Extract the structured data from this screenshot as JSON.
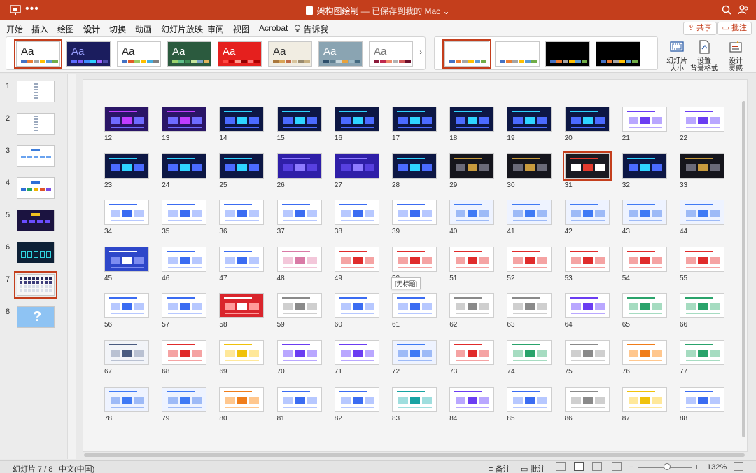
{
  "titlebar": {
    "doc_name": "架构图绘制",
    "save_status": " — 已保存到我的 Mac",
    "chevron": "⌄",
    "more": "•••"
  },
  "menu": {
    "tabs": [
      "开始",
      "插入",
      "绘图",
      "设计",
      "切换",
      "动画",
      "幻灯片放映",
      "审阅",
      "视图",
      "Acrobat",
      "告诉我"
    ],
    "active_tab": "设计",
    "share": "共享",
    "comment": "批注"
  },
  "ribbon": {
    "theme_label": "Aa",
    "themes": [
      {
        "bg": "#ffffff",
        "fg": "#222222",
        "bars": [
          "#4472c4",
          "#ed7d31",
          "#a5a5a5",
          "#ffc000",
          "#5b9bd5",
          "#70ad47"
        ]
      },
      {
        "bg": "#1b1d5e",
        "fg": "#9aa0ff",
        "bars": [
          "#5b6cff",
          "#7b58ff",
          "#3d8bff",
          "#2bd0ff",
          "#9d65ff",
          "#4b4ba8"
        ]
      },
      {
        "bg": "#ffffff",
        "fg": "#222222",
        "bars": [
          "#4472c4",
          "#e15b26",
          "#9ccb64",
          "#ffc000",
          "#44aee0",
          "#7f7f7f"
        ]
      },
      {
        "bg": "#2b5a3e",
        "fg": "#ffffff",
        "bars": [
          "#9bd36e",
          "#5fbf8a",
          "#3e8f56",
          "#c5e49c",
          "#7aa2c8",
          "#e2b35d"
        ]
      },
      {
        "bg": "#e5201e",
        "fg": "#ffffff",
        "bars": [
          "#ff4a44",
          "#c00000",
          "#ff9c8f",
          "#8f0000",
          "#f77",
          "#a80000"
        ]
      },
      {
        "bg": "#f1ede2",
        "fg": "#333333",
        "bars": [
          "#a9773b",
          "#d9a557",
          "#c06a45",
          "#d8c49c",
          "#9a8b6e",
          "#c9b182"
        ]
      },
      {
        "bg": "#8aa4b2",
        "fg": "#ffffff",
        "bars": [
          "#2e4f6b",
          "#5e7f91",
          "#c8d8de",
          "#e8a33d",
          "#9cbac7",
          "#436a80"
        ]
      },
      {
        "bg": "#ffffff",
        "fg": "#777777",
        "bars": [
          "#8b1a3a",
          "#c0294e",
          "#ef8c6a",
          "#b3b3b3",
          "#d35b5b",
          "#6b0f2a"
        ]
      }
    ],
    "variants": [
      {
        "bg": "#ffffff",
        "bars": [
          "#4472c4",
          "#ed7d31",
          "#a5a5a5",
          "#ffc000",
          "#5b9bd5",
          "#70ad47"
        ]
      },
      {
        "bg": "#ffffff",
        "bars": [
          "#4472c4",
          "#ed7d31",
          "#a5a5a5",
          "#ffc000",
          "#5b9bd5",
          "#70ad47"
        ]
      },
      {
        "bg": "#000000",
        "bars": [
          "#4472c4",
          "#ed7d31",
          "#a5a5a5",
          "#ffc000",
          "#5b9bd5",
          "#70ad47"
        ]
      },
      {
        "bg": "#000000",
        "bars": [
          "#4472c4",
          "#ed7d31",
          "#a5a5a5",
          "#ffc000",
          "#5b9bd5",
          "#70ad47"
        ]
      }
    ],
    "slide_size_l1": "幻灯片",
    "slide_size_l2": "大小",
    "format_bg_l1": "设置",
    "format_bg_l2": "背景格式",
    "designer_l1": "设计",
    "designer_l2": "灵感",
    "gallery_more": "›"
  },
  "left_thumbs": [
    {
      "num": "1",
      "kind": "vertical"
    },
    {
      "num": "2",
      "kind": "vertical"
    },
    {
      "num": "3",
      "kind": "tree-blue"
    },
    {
      "num": "4",
      "kind": "tree-color"
    },
    {
      "num": "5",
      "kind": "dark-tree"
    },
    {
      "num": "6",
      "kind": "teal-dark"
    },
    {
      "num": "7",
      "kind": "sorter"
    },
    {
      "num": "8",
      "kind": "question"
    }
  ],
  "slides": {
    "first": 12,
    "last": 88,
    "per_row": 11,
    "selected": 31,
    "tooltip_on": 50,
    "tooltip": "[无标题]",
    "styles": {
      "12": "purple",
      "13": "purple",
      "14": "navy",
      "15": "navy",
      "16": "navy",
      "17": "navy",
      "18": "navy",
      "19": "navy",
      "20": "navy",
      "21": "white-purple",
      "22": "white-purple",
      "23": "navy",
      "24": "navy",
      "25": "navy",
      "26": "violet",
      "27": "violet",
      "28": "navy",
      "29": "black",
      "30": "black",
      "31": "black-red",
      "32": "navy",
      "33": "black",
      "34": "white-blue",
      "35": "white-blue",
      "36": "white-blue",
      "37": "white-blue",
      "38": "white-blue",
      "39": "white-blue",
      "40": "light-blue",
      "41": "light-blue",
      "42": "light-blue",
      "43": "light-blue",
      "44": "light-blue",
      "45": "blue-dark",
      "46": "white-blue",
      "47": "white-blue",
      "48": "white-pink",
      "49": "white-red",
      "50": "white-red",
      "51": "white-red",
      "52": "white-red",
      "53": "white-red",
      "54": "white-red",
      "55": "white-red",
      "56": "white-blue",
      "57": "white-blue",
      "58": "red",
      "59": "white-gray",
      "60": "white-blue",
      "61": "white-blue",
      "62": "white-gray",
      "63": "white-gray",
      "64": "white-purple",
      "65": "white-green",
      "66": "white-green",
      "67": "light-gray",
      "68": "white-red",
      "69": "white-yellow",
      "70": "white-purple",
      "71": "white-purple",
      "72": "light-blue",
      "73": "white-red",
      "74": "white-green",
      "75": "white-gray",
      "76": "white-orange",
      "77": "white-green",
      "78": "light-blue",
      "79": "light-blue",
      "80": "white-orange",
      "81": "white-blue",
      "82": "white-blue",
      "83": "white-teal",
      "84": "white-purple",
      "85": "white-blue",
      "86": "white-gray",
      "87": "white-yellow",
      "88": "white-blue"
    },
    "palette": {
      "purple": {
        "bg": "#2a1566",
        "a": "#c03cff",
        "b": "#6f6bff"
      },
      "navy": {
        "bg": "#0d1744",
        "a": "#2ed4ff",
        "b": "#4b6bff"
      },
      "violet": {
        "bg": "#2f1fa8",
        "a": "#8e7bff",
        "b": "#5740e0"
      },
      "black": {
        "bg": "#15151c",
        "a": "#c79a3d",
        "b": "#6a6a78"
      },
      "black-red": {
        "bg": "#1a1a22",
        "a": "#e33a2e",
        "b": "#ffffff"
      },
      "white-purple": {
        "bg": "#ffffff",
        "a": "#6b3df2",
        "b": "#b9a7ff"
      },
      "white-blue": {
        "bg": "#ffffff",
        "a": "#3b6cf2",
        "b": "#b7c8ff"
      },
      "light-blue": {
        "bg": "#eef3ff",
        "a": "#3f7af5",
        "b": "#9dbaf7"
      },
      "blue-dark": {
        "bg": "#2e47c9",
        "a": "#ffffff",
        "b": "#7d8cf0"
      },
      "white-pink": {
        "bg": "#ffffff",
        "a": "#d97aa6",
        "b": "#f3c7da"
      },
      "white-red": {
        "bg": "#ffffff",
        "a": "#e02b2b",
        "b": "#f5a3a3"
      },
      "red": {
        "bg": "#d9252c",
        "a": "#ffffff",
        "b": "#ff9a9a"
      },
      "white-gray": {
        "bg": "#ffffff",
        "a": "#8a8a8a",
        "b": "#cfcfcf"
      },
      "white-green": {
        "bg": "#ffffff",
        "a": "#2aa36b",
        "b": "#a6dcc1"
      },
      "light-gray": {
        "bg": "#f2f4f8",
        "a": "#4a5b80",
        "b": "#b9c1d2"
      },
      "white-yellow": {
        "bg": "#ffffff",
        "a": "#f0c20b",
        "b": "#ffe89a"
      },
      "white-orange": {
        "bg": "#ffffff",
        "a": "#f07d1a",
        "b": "#ffc78e"
      },
      "white-teal": {
        "bg": "#ffffff",
        "a": "#17a3a3",
        "b": "#9fdede"
      }
    }
  },
  "status": {
    "slide_counter": "幻灯片 7 / 8",
    "language": "中文(中国)",
    "notes": "备注",
    "comments": "批注",
    "zoom_minus": "−",
    "zoom_plus": "+",
    "zoom": "132%"
  },
  "colors": {
    "accent": "#c43e1c"
  }
}
